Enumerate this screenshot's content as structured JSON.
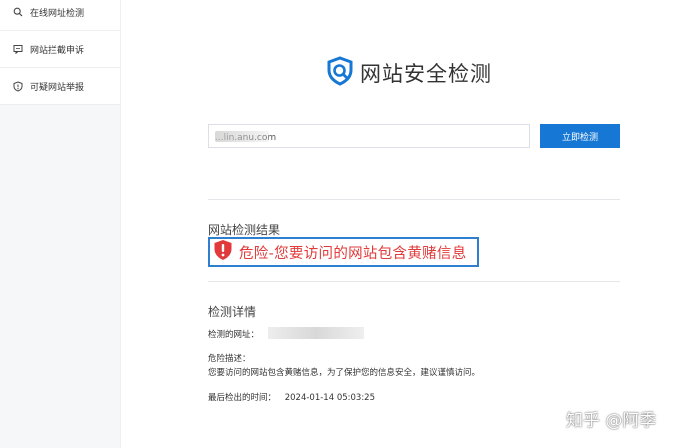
{
  "sidebar": {
    "items": [
      {
        "label": "在线网址检测",
        "icon": "search-icon"
      },
      {
        "label": "网站拦截申诉",
        "icon": "message-icon"
      },
      {
        "label": "可疑网站举报",
        "icon": "shield-icon"
      }
    ]
  },
  "brand": {
    "title": "网站安全检测",
    "logo_color": "#1677d4"
  },
  "search": {
    "value": "...lin.anu.com",
    "button_label": "立即检测"
  },
  "result": {
    "section_title": "网站检测结果",
    "status_text": "危险-您要访问的网站包含黄赌信息",
    "status_color": "#e03a3a"
  },
  "details": {
    "section_title": "检测详情",
    "url_label": "检测的网址：",
    "danger_label": "危险描述：",
    "danger_desc": "您要访问的网站包含黄赌信息，为了保护您的信息安全，建议谨慎访问。",
    "last_time_label": "最后检出的时间：",
    "last_time_value": "2024-01-14 05:03:25"
  },
  "watermark": "知乎 @阿季"
}
